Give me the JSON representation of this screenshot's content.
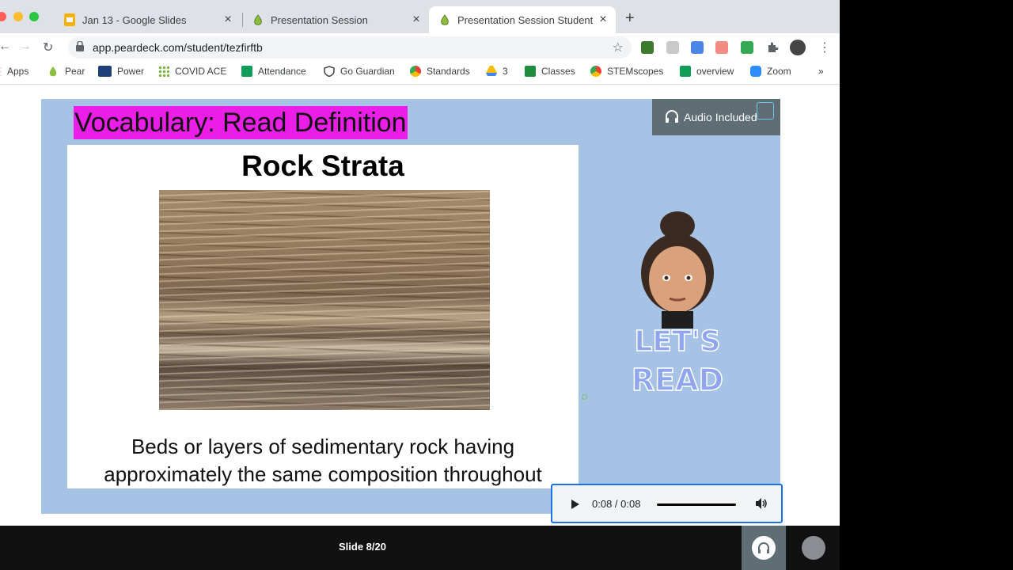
{
  "tabs": [
    {
      "title": "Jan 13 - Google Slides",
      "icon": "google-slides-icon"
    },
    {
      "title": "Presentation Session",
      "icon": "pear-icon"
    },
    {
      "title": "Presentation Session Student",
      "icon": "pear-icon",
      "active": true
    }
  ],
  "toolbar": {
    "url": "app.peardeck.com/student/tezfirftb"
  },
  "bookmarks": [
    {
      "label": "Apps",
      "icon": "apps-grid-icon"
    },
    {
      "label": "Pear",
      "icon": "pear-icon"
    },
    {
      "label": "Power",
      "icon": "sis-icon"
    },
    {
      "label": "COVID ACE",
      "icon": "dots-icon"
    },
    {
      "label": "Attendance",
      "icon": "google-sheets-icon"
    },
    {
      "label": "Go Guardian",
      "icon": "shield-icon"
    },
    {
      "label": "Standards",
      "icon": "chrome-icon"
    },
    {
      "label": "3",
      "icon": "google-drive-icon"
    },
    {
      "label": "Classes",
      "icon": "google-classroom-icon"
    },
    {
      "label": "STEMscopes",
      "icon": "chrome-icon"
    },
    {
      "label": "overview",
      "icon": "google-sheets-icon"
    },
    {
      "label": "Zoom",
      "icon": "zoom-icon"
    }
  ],
  "slide": {
    "title": "Vocabulary: Read Definition",
    "term": "Rock Strata",
    "definition_line1": "Beds or layers of sedimentary rock having",
    "definition_line2": "approximately the same composition throughout",
    "audio_badge": "Audio Included",
    "sticker_text_1": "LET'S",
    "sticker_text_2": "READ"
  },
  "audio_player": {
    "time": "0:08 / 0:08",
    "progress": 1.0
  },
  "footer": {
    "slide_counter": "Slide 8/20"
  },
  "colors": {
    "slide_bg": "#a6c2e4",
    "title_highlight": "#ea1ee7",
    "badge_bg": "#5f6d75"
  }
}
